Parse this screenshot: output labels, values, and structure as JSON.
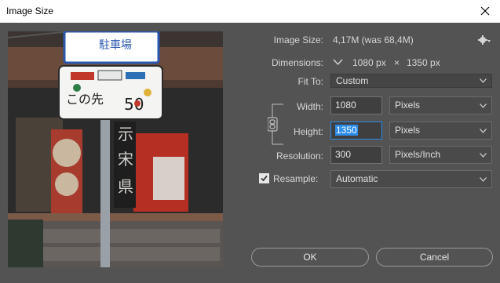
{
  "window": {
    "title": "Image Size"
  },
  "image_size": {
    "label": "Image Size:",
    "value": "4,17M (was 68,4M)"
  },
  "dimensions": {
    "label": "Dimensions:",
    "width": "1080 px",
    "times": "×",
    "height": "1350 px"
  },
  "fit_to": {
    "label": "Fit To:",
    "value": "Custom"
  },
  "width": {
    "label": "Width:",
    "value": "1080",
    "unit": "Pixels"
  },
  "height": {
    "label": "Height:",
    "value": "1350",
    "unit": "Pixels"
  },
  "resolution": {
    "label": "Resolution:",
    "value": "300",
    "unit": "Pixels/Inch"
  },
  "resample": {
    "label": "Resample:",
    "checked": true,
    "value": "Automatic"
  },
  "buttons": {
    "ok": "OK",
    "cancel": "Cancel"
  },
  "icons": {
    "close": "close-icon",
    "gear": "gear-icon",
    "chain": "chain-link-icon",
    "dimensions_toggle": "chevron-down-icon"
  }
}
